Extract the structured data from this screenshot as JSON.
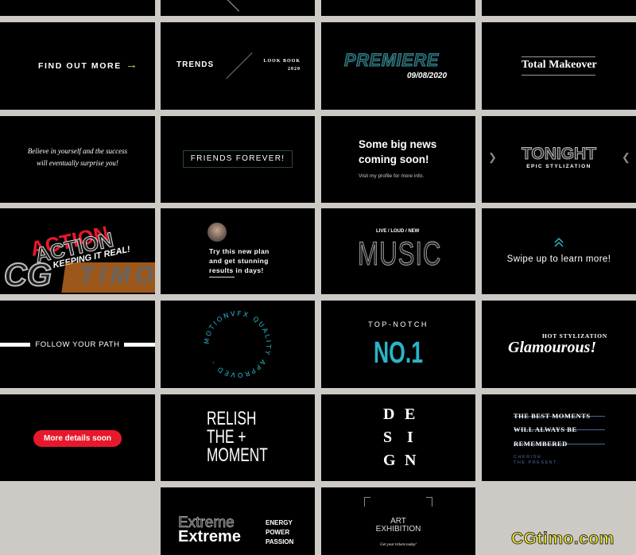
{
  "colors": {
    "tile_bg": "#000000",
    "gutter": "#cdcac6",
    "accent_yellow": "#e8d23a",
    "accent_teal": "#2ab5c8",
    "accent_red": "#e8182c",
    "accent_blue": "#4a6a9a"
  },
  "tiles": {
    "find_out_more": {
      "label": "FIND OUT MORE",
      "icon": "arrow-right-icon",
      "arrow": "→"
    },
    "trends": {
      "title": "TRENDS",
      "sub1": "LOOK BOOK",
      "sub2": "2020"
    },
    "premiere": {
      "title": "PREMIERE",
      "date": "09/08/2020"
    },
    "total_makeover": {
      "title": "Total Makeover"
    },
    "believe": {
      "line1": "Believe in yourself and the success",
      "line2": "will eventually surprise you!"
    },
    "friends": {
      "title": "FRIENDS FOREVER!"
    },
    "big_news": {
      "line1": "Some big news",
      "line2": "coming soon!",
      "sub": "Visit my profile for more info."
    },
    "tonight": {
      "title": "TONIGHT",
      "sub": "EPIC STYLIZATION",
      "left": "❯",
      "right": "❮"
    },
    "action": {
      "title": "ACTION",
      "sub": "KEEPING IT REAL!"
    },
    "plan": {
      "line1": "Try this new plan",
      "line2": "and get stunning",
      "line3": "results in days!"
    },
    "music": {
      "top": "LIVE / LOUD / NEW",
      "title": "MUSIC"
    },
    "swipe": {
      "label": "Swipe up to learn more!",
      "icon": "chevron-up-icon"
    },
    "follow": {
      "label": "FOLLOW YOUR PATH"
    },
    "circle": {
      "text": "MOTIONVFX QUALITY APPROVED - "
    },
    "top_notch": {
      "top": "TOP-NOTCH",
      "title": "NO.1"
    },
    "glam": {
      "top": "HOT STYLIZATION",
      "title": "Glamourous!"
    },
    "more_details": {
      "label": "More details soon"
    },
    "relish": {
      "line1": "RELISH",
      "line2": "THE +",
      "line3": "MOMENT"
    },
    "design": {
      "letters": [
        "D",
        "E",
        "S",
        "I",
        "G",
        "N"
      ]
    },
    "moments": {
      "line1": "THE BEST MOMENTS",
      "line2": "WILL ALWAYS BE",
      "line3": "REMEMBERED",
      "sub1": "CHERISH",
      "sub2": "THE PRESENT"
    },
    "extreme": {
      "outline": "Extreme",
      "bold": "Extreme",
      "w1": "ENERGY",
      "w2": "POWER",
      "w3": "PASSION"
    },
    "art": {
      "line1": "ART",
      "line2": "EXHIBITION",
      "sub": "Get your tickets today!"
    }
  },
  "watermarks": {
    "left": "CGTIMO",
    "right": "CGtimo.com"
  }
}
